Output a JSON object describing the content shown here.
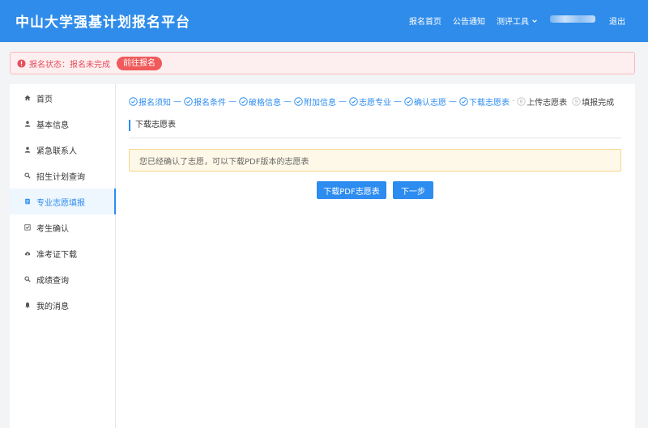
{
  "header": {
    "title": "中山大学强基计划报名平台",
    "nav": {
      "home": "报名首页",
      "notice": "公告通知",
      "tools": "测评工具",
      "logout": "退出"
    }
  },
  "alert": {
    "status_text": "报名状态：报名未完成",
    "button_label": "前往报名"
  },
  "sidebar": {
    "items": [
      {
        "label": "首页",
        "icon": "home-icon"
      },
      {
        "label": "基本信息",
        "icon": "user-icon"
      },
      {
        "label": "紧急联系人",
        "icon": "user-icon"
      },
      {
        "label": "招生计划查询",
        "icon": "search-icon"
      },
      {
        "label": "专业志愿填报",
        "icon": "document-icon",
        "active": true
      },
      {
        "label": "考生确认",
        "icon": "checkbox-icon"
      },
      {
        "label": "准考证下载",
        "icon": "cloud-download-icon"
      },
      {
        "label": "成绩查询",
        "icon": "search-icon"
      },
      {
        "label": "我的消息",
        "icon": "bell-icon"
      }
    ]
  },
  "steps": [
    {
      "label": "报名须知",
      "status": "done"
    },
    {
      "label": "报名条件",
      "status": "done"
    },
    {
      "label": "破格信息",
      "status": "done"
    },
    {
      "label": "附加信息",
      "status": "done"
    },
    {
      "label": "志愿专业",
      "status": "done"
    },
    {
      "label": "确认志愿",
      "status": "done"
    },
    {
      "label": "下载志愿表",
      "status": "current"
    },
    {
      "label": "上传志愿表",
      "status": "pending",
      "number": "8"
    },
    {
      "label": "填报完成",
      "status": "pending",
      "number": "9"
    }
  ],
  "section": {
    "title": "下载志愿表",
    "notice": "您已经确认了志愿，可以下载PDF版本的志愿表"
  },
  "buttons": {
    "download": "下载PDF志愿表",
    "next": "下一步"
  },
  "colors": {
    "header": "#2f8cea",
    "primary": "#2d8cf0",
    "alert_text": "#e64f5c",
    "alert_bg": "#fdeff0",
    "notice_bg": "#fef8e8",
    "notice_border": "#f9d58a"
  }
}
